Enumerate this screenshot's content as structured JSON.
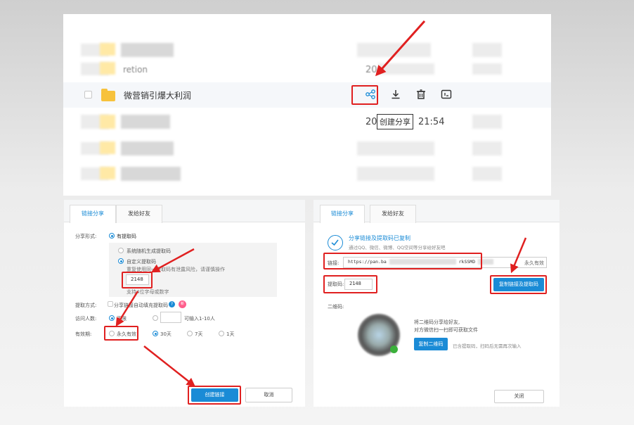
{
  "file_list": {
    "row_top_1_name": "retion",
    "row_top_1_time": "20",
    "selected_row": {
      "name": "微营销引爆大利润"
    },
    "tooltip": "创建分享",
    "row_time_prefix": "20",
    "row_time_suffix": "21:54",
    "icons": [
      "share-icon",
      "download-icon",
      "delete-icon",
      "more-icon"
    ]
  },
  "share_form": {
    "tabs": [
      "链接分享",
      "发给好友"
    ],
    "share_mode_label": "分享形式:",
    "share_mode_value": "有提取码",
    "option_random": "系统随机生成提取码",
    "option_custom": "自定义提取码",
    "custom_warning": "重复使用同一提取码有泄露风险，请谨慎操作",
    "code_value": "2148",
    "code_hint": "支持4位字母或数字",
    "extract_label": "提取方式:",
    "extract_checkbox": "分享链接自动填充提取码",
    "new_badge": "新",
    "visitors_label": "访问人数:",
    "visitors_unlimited": "不限",
    "visitors_hint": "可输入1-10人",
    "validity_label": "有效期:",
    "validity_options": [
      "永久有效",
      "30天",
      "7天",
      "1天"
    ],
    "create_button": "创建链接",
    "cancel_button": "取消"
  },
  "share_result": {
    "tabs": [
      "链接分享",
      "发给好友"
    ],
    "success_title": "分享链接及提取码已复制",
    "success_sub": "通过QQ、微信、微博、QQ空间等分享给好友吧",
    "link_label": "链接:",
    "link_value": "https://pan.ba",
    "link_tail": "rkSSMD",
    "link_validity": "永久有效",
    "code_label": "提取码:",
    "code_value": "2148",
    "copy_link_button": "复制链接及提取码",
    "qr_label": "二维码:",
    "qr_text_1": "将二维码分享给好友,",
    "qr_text_2": "对方微信扫一扫即可获取文件",
    "copy_qr_button": "复制二维码",
    "qr_note": "已含提取码，扫码后无需再次输入",
    "close_button": "关闭"
  },
  "colors": {
    "accent": "#1a8bd6",
    "highlight": "#e02020",
    "folder": "#f7c23c"
  }
}
